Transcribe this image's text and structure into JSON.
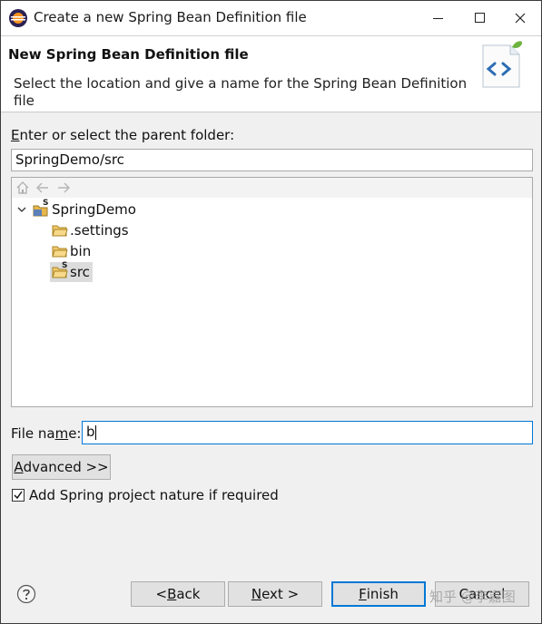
{
  "window": {
    "title": "Create a new Spring Bean Definition file"
  },
  "banner": {
    "title": "New Spring Bean Definition file",
    "description": "Select the location and give a name for the Spring Bean Definition file"
  },
  "parent_folder": {
    "label_pre": "",
    "label_mnemonic": "E",
    "label_post": "nter or select the parent folder:",
    "value": "SpringDemo/src"
  },
  "tree": {
    "project": {
      "label": "SpringDemo",
      "badge": "S"
    },
    "children": [
      {
        "label": ".settings"
      },
      {
        "label": "bin"
      },
      {
        "label": "src",
        "badge": "S",
        "selected": true
      }
    ]
  },
  "file_name": {
    "label_pre": "File na",
    "label_mnemonic": "m",
    "label_post": "e:",
    "value": "b"
  },
  "advanced_button": {
    "pre": "",
    "mnemonic": "A",
    "post": "dvanced >>"
  },
  "spring_nature_checkbox": {
    "label": "Add Spring project nature if required",
    "checked": true
  },
  "buttons": {
    "back": {
      "pre": "< ",
      "mnemonic": "B",
      "post": "ack"
    },
    "next": {
      "pre": "",
      "mnemonic": "N",
      "post": "ext >"
    },
    "finish": {
      "pre": "",
      "mnemonic": "F",
      "post": "inish"
    },
    "cancel": {
      "label": "Cancel"
    }
  },
  "watermark": "知乎 @李嘉图",
  "icons": {
    "app": "eclipse-icon",
    "banner": "spring-bean-file-icon",
    "help": "help-icon"
  },
  "colors": {
    "accent": "#0078d7",
    "folder": "#e8b64b",
    "selection": "#dcdcdc"
  }
}
